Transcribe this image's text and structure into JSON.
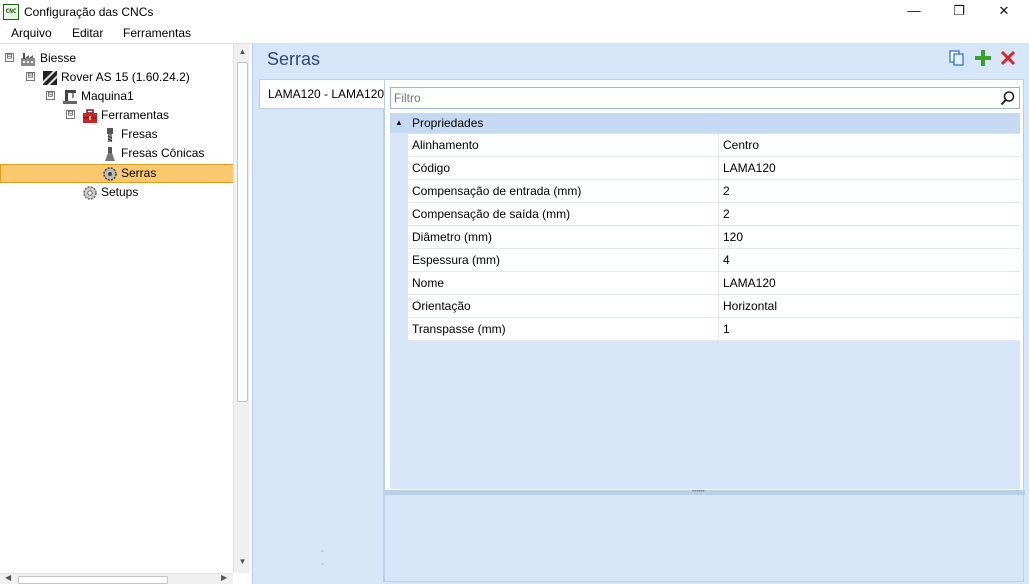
{
  "window": {
    "title": "Configuração das CNCs",
    "app_icon_text": "CNC",
    "minimize_glyph": "—",
    "maximize_glyph": "❐",
    "close_glyph": "✕"
  },
  "menu": {
    "items": [
      "Arquivo",
      "Editar",
      "Ferramentas"
    ]
  },
  "tree": {
    "nodes": [
      {
        "label": "Biesse",
        "icon": "factory-icon",
        "expander": "⊟"
      },
      {
        "label": "Rover AS 15 (1.60.24.2)",
        "icon": "machine-stripes-icon",
        "expander": "⊟"
      },
      {
        "label": "Maquina1",
        "icon": "machine-icon",
        "expander": "⊟"
      },
      {
        "label": "Ferramentas",
        "icon": "toolbox-icon",
        "expander": "⊟"
      },
      {
        "label": "Fresas",
        "icon": "router-bit-icon"
      },
      {
        "label": "Fresas Cônicas",
        "icon": "conical-bit-icon"
      },
      {
        "label": "Serras",
        "icon": "saw-gear-icon",
        "selected": true
      },
      {
        "label": "Setups",
        "icon": "gear-icon"
      }
    ]
  },
  "content": {
    "page_title": "Serras",
    "list_items": [
      "LAMA120 - LAMA120"
    ],
    "filter_placeholder": "Filtro",
    "category_label": "Propriedades",
    "properties": [
      {
        "name": "Alinhamento",
        "value": "Centro"
      },
      {
        "name": "Código",
        "value": "LAMA120"
      },
      {
        "name": "Compensação de entrada (mm)",
        "value": "2"
      },
      {
        "name": "Compensação de saída (mm)",
        "value": "2"
      },
      {
        "name": "Diâmetro (mm)",
        "value": "120"
      },
      {
        "name": "Espessura (mm)",
        "value": "4"
      },
      {
        "name": "Nome",
        "value": "LAMA120"
      },
      {
        "name": "Orientação",
        "value": "Horizontal"
      },
      {
        "name": "Transpasse (mm)",
        "value": "1"
      }
    ]
  },
  "colors": {
    "selection": "#fac96f",
    "panel_blue": "#d6e6f8",
    "add_green": "#3aa12c",
    "delete_red": "#d9262b"
  }
}
